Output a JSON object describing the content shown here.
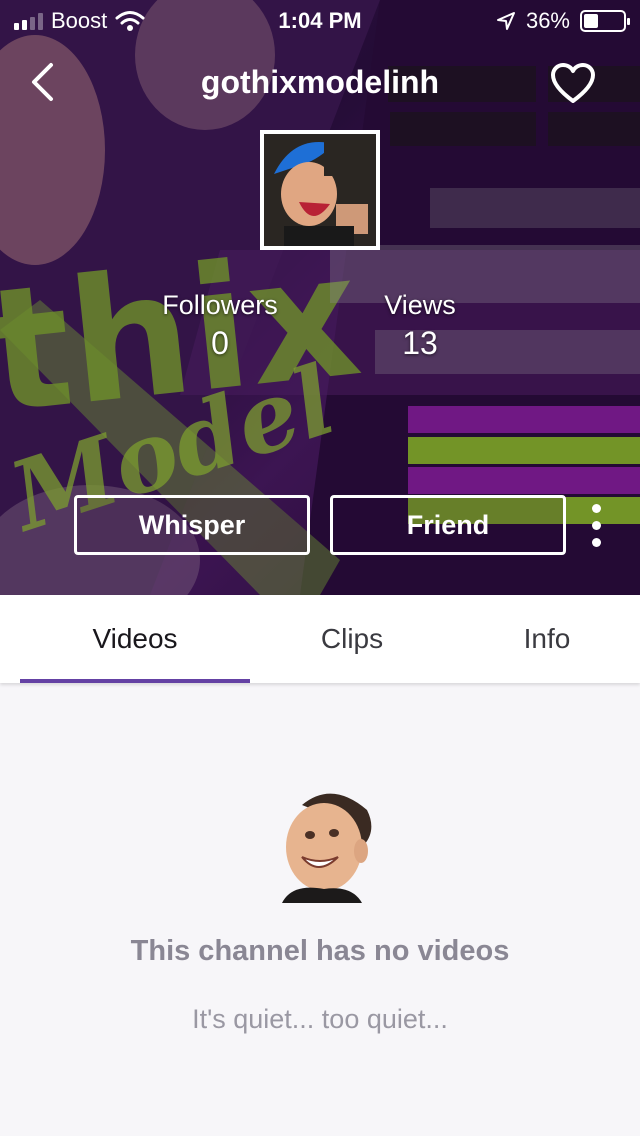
{
  "status_bar": {
    "carrier": "Boost",
    "time": "1:04 PM",
    "battery_percent": "36%",
    "battery_level": 0.36
  },
  "header": {
    "channel_name": "gothixmodelinh",
    "back_icon": "chevron-left-icon",
    "follow_icon": "heart-icon"
  },
  "stats": {
    "followers_label": "Followers",
    "followers_value": "0",
    "views_label": "Views",
    "views_value": "13"
  },
  "actions": {
    "whisper_label": "Whisper",
    "friend_label": "Friend",
    "more_icon": "more-vertical-icon"
  },
  "tabs": [
    {
      "label": "Videos",
      "active": true
    },
    {
      "label": "Clips",
      "active": false
    },
    {
      "label": "Info",
      "active": false
    }
  ],
  "empty_state": {
    "title": "This channel has no videos",
    "subtitle": "It's quiet... too quiet..."
  },
  "colors": {
    "accent": "#6441a4",
    "banner_purple": "#3a1652",
    "text_muted": "#8a8794"
  }
}
